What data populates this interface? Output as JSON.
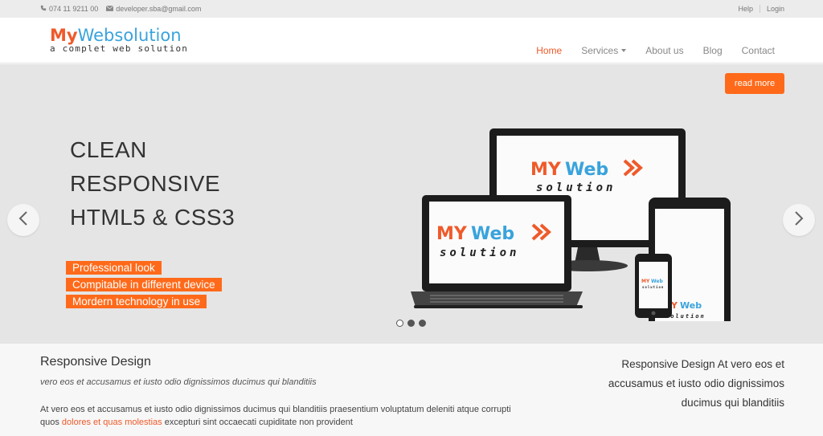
{
  "topbar": {
    "phone": "074 11 9211 00",
    "email": "developer.sba@gmail.com",
    "help": "Help",
    "login": "Login"
  },
  "logo": {
    "my": "My",
    "web": "Web",
    "solution": "solution",
    "tagline": "a complet web solution"
  },
  "nav": {
    "items": [
      "Home",
      "Services",
      "About us",
      "Blog",
      "Contact"
    ]
  },
  "hero": {
    "headline": [
      "CLEAN",
      "RESPONSIVE",
      "HTML5 & CSS3"
    ],
    "features": [
      "Professional look",
      "Compitable in different device",
      "Mordern technology in use"
    ],
    "device_logo": {
      "my": "MY",
      "web": "Web",
      "solution": "solution"
    }
  },
  "bottom": {
    "title": "Responsive Design",
    "subtitle": "vero eos et accusamus et iusto odio dignissimos ducimus qui blanditiis",
    "para_part1": "At vero eos et accusamus et iusto odio dignissimos ducimus qui blanditiis praesentium voluptatum deleniti atque corrupti quos ",
    "para_highlight": "dolores et quas molestias",
    "para_part2": " excepturi sint occaecati cupiditate non provident",
    "right_text": "Responsive Design At vero eos et accusamus et iusto odio dignissimos ducimus qui blanditiis",
    "read_more": "read more"
  },
  "colors": {
    "accent": "#ef5a2a",
    "orange_bg": "#ff6a1a",
    "blue": "#39a3dc",
    "hero_bg": "#e5e5e5"
  }
}
